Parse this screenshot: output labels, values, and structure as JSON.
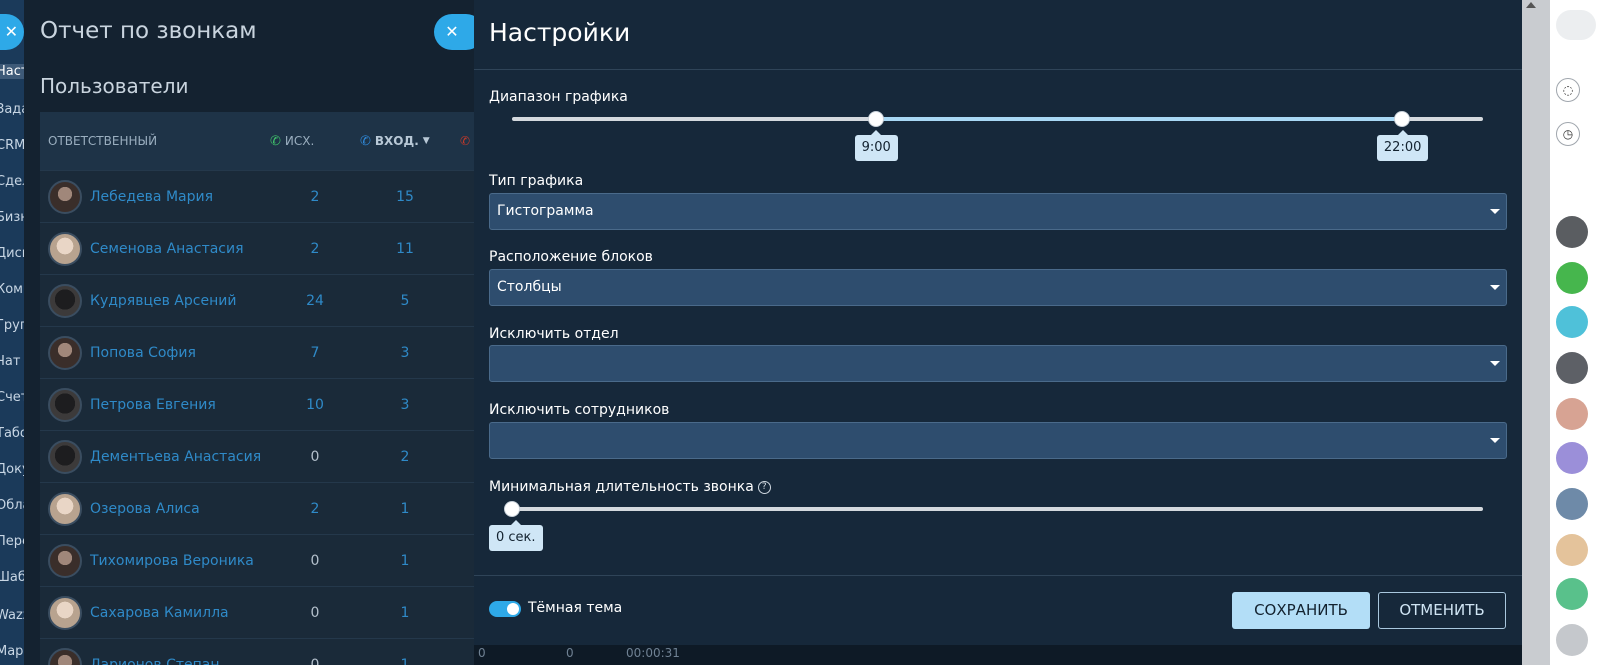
{
  "app_sidebar": {
    "items": [
      "Наст",
      "Зада",
      "CRM",
      "Сдел",
      "Бизн",
      "Диск",
      "Комп",
      "Груп",
      "Чат и",
      "Счет",
      "Табо",
      "Доку",
      "Обла",
      "Пере",
      "Шаб",
      "Wazz",
      "Мар"
    ]
  },
  "report": {
    "title": "Отчет по звонкам",
    "subtitle": "Пользователи",
    "columns": {
      "responsible": "ОТВЕТСТВЕННЫЙ",
      "outgoing": "ИСХ.",
      "incoming": "ВХОД."
    },
    "rows": [
      {
        "name": "Лебедева Мария",
        "out": "2",
        "in": "15"
      },
      {
        "name": "Семенова Анастасия",
        "out": "2",
        "in": "11"
      },
      {
        "name": "Кудрявцев Арсений",
        "out": "24",
        "in": "5"
      },
      {
        "name": "Попова София",
        "out": "7",
        "in": "3"
      },
      {
        "name": "Петрова Евгения",
        "out": "10",
        "in": "3"
      },
      {
        "name": "Дементьева Анастасия",
        "out": "0",
        "in": "2"
      },
      {
        "name": "Озерова Алиса",
        "out": "2",
        "in": "1"
      },
      {
        "name": "Тихомирова Вероника",
        "out": "0",
        "in": "1"
      },
      {
        "name": "Сахарова Камилла",
        "out": "0",
        "in": "1"
      },
      {
        "name": "Ларионов Степан",
        "out": "0",
        "in": "1"
      }
    ]
  },
  "settings": {
    "title": "Настройки",
    "range": {
      "label": "Диапазон графика",
      "from": "9:00",
      "to": "22:00",
      "from_fraction": 0.375,
      "to_fraction": 0.917
    },
    "chart_type": {
      "label": "Тип графика",
      "value": "Гистограмма"
    },
    "blocks_layout": {
      "label": "Расположение блоков",
      "value": "Столбцы"
    },
    "exclude_department": {
      "label": "Исключить отдел",
      "value": ""
    },
    "exclude_employees": {
      "label": "Исключить сотрудников",
      "value": ""
    },
    "min_duration": {
      "label": "Минимальная длительность звонка",
      "help": "?",
      "value": "0 сек.",
      "fraction": 0
    },
    "dark_theme": {
      "label": "Тёмная тема",
      "enabled": true
    },
    "save_label": "СОХРАНИТЬ",
    "cancel_label": "ОТМЕНИТЬ",
    "bottom_peek": [
      "0",
      "0",
      "00:00:31"
    ]
  },
  "icons": {
    "close": "close-icon",
    "phone": "phone-icon",
    "caret": "chevron-down-icon",
    "help": "help-icon"
  },
  "colors": {
    "accent": "#2ea9e8",
    "modal_bg": "#16283a",
    "select_bg": "#2e4d6e",
    "save_bg": "#b3def7"
  }
}
